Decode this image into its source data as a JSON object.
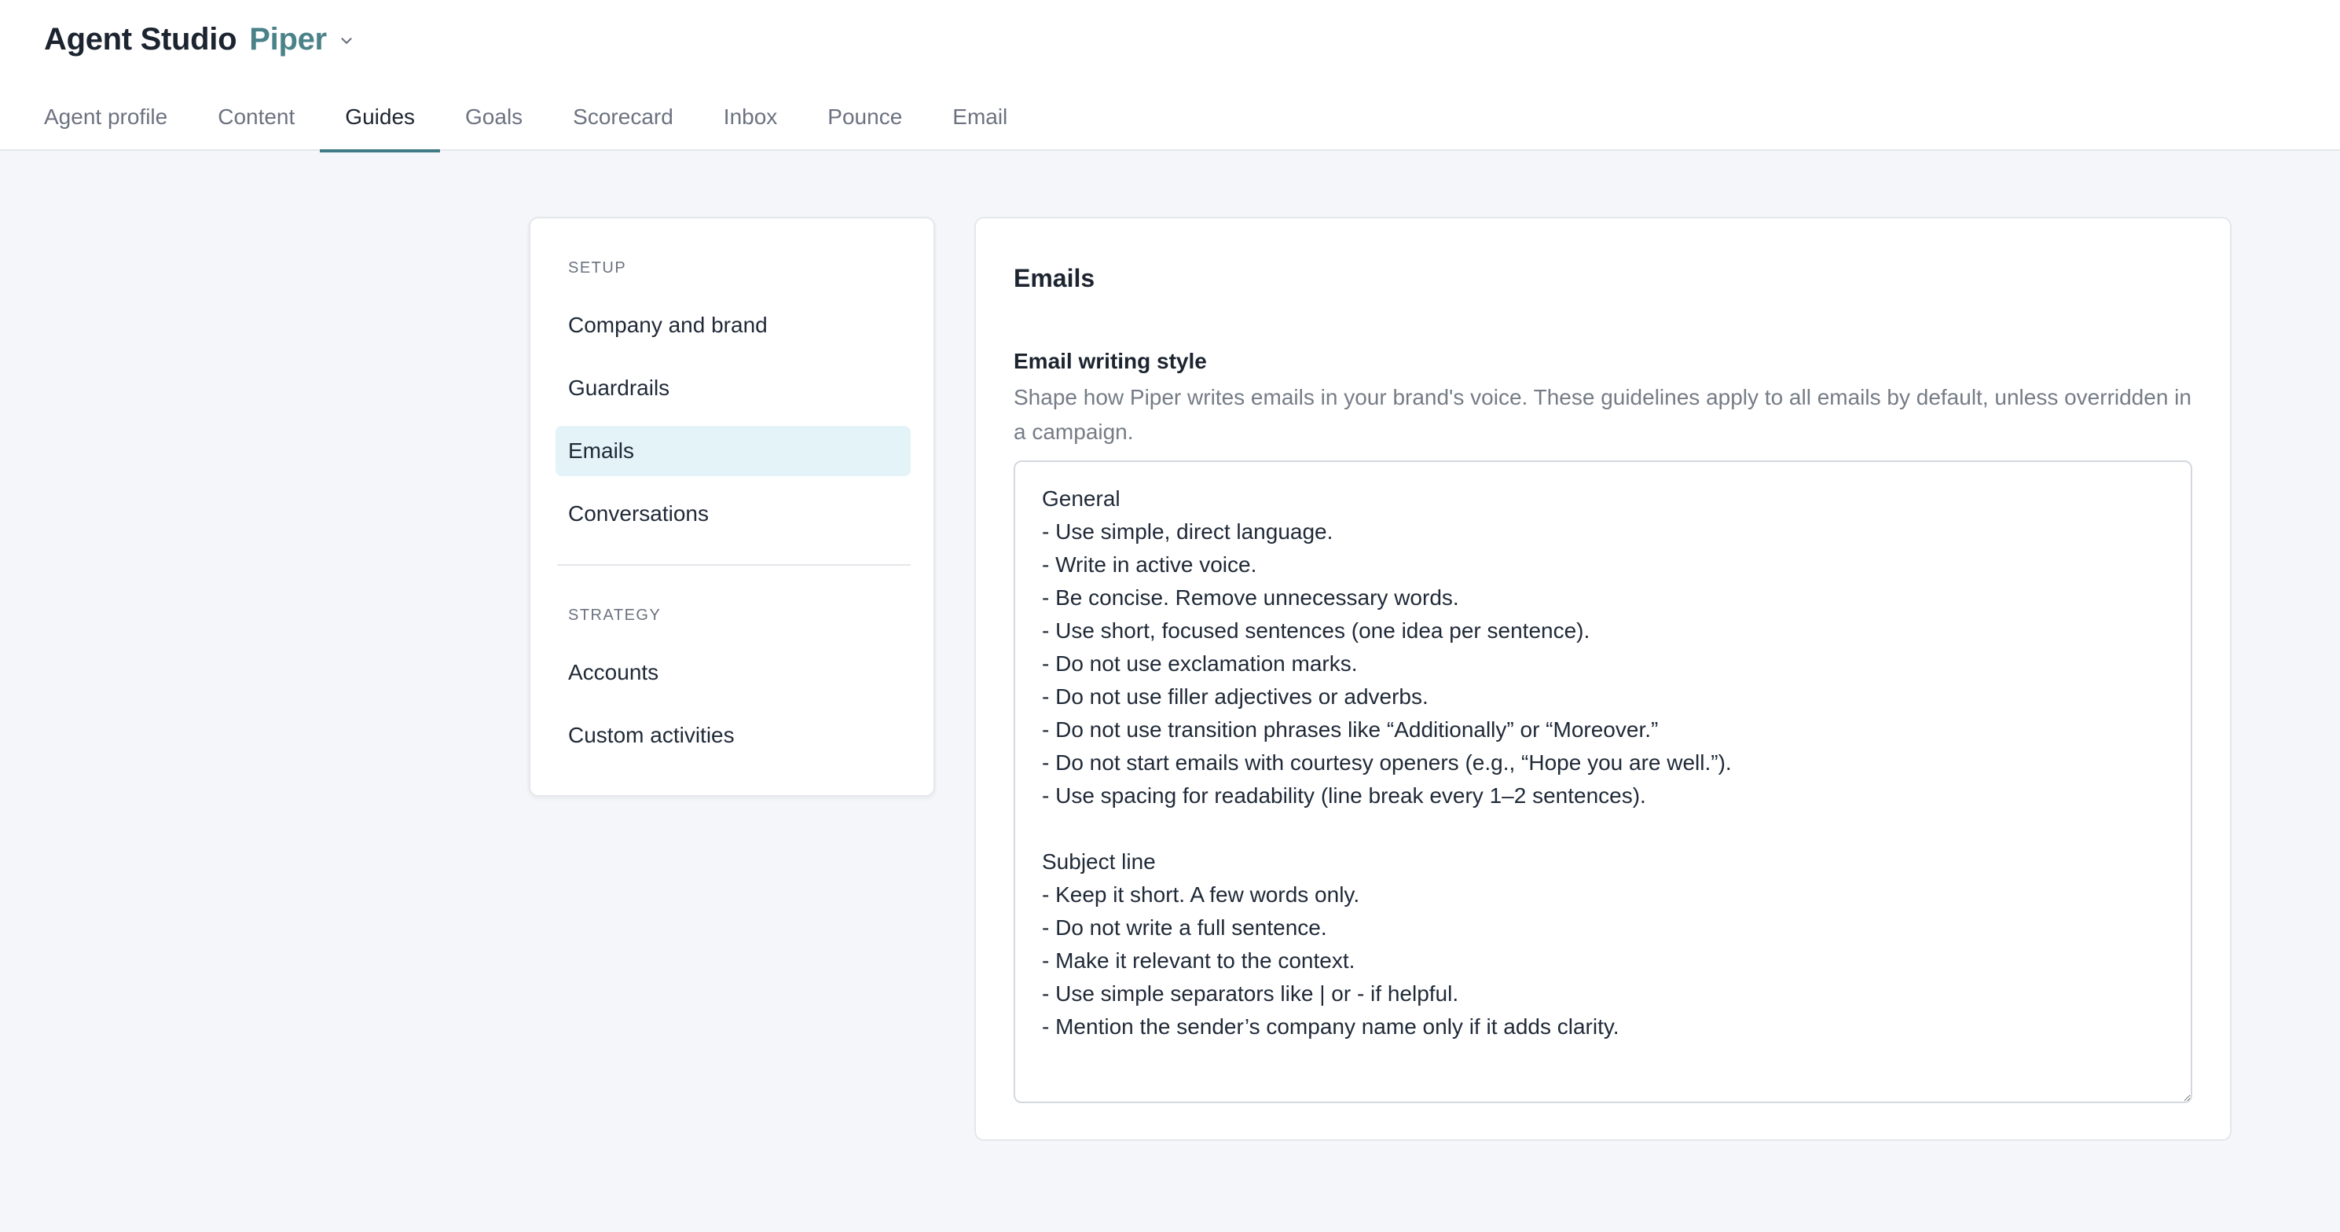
{
  "header": {
    "app_title": "Agent Studio",
    "agent_name": "Piper"
  },
  "tabs": [
    {
      "label": "Agent profile"
    },
    {
      "label": "Content"
    },
    {
      "label": "Guides",
      "active": true
    },
    {
      "label": "Goals"
    },
    {
      "label": "Scorecard"
    },
    {
      "label": "Inbox"
    },
    {
      "label": "Pounce"
    },
    {
      "label": "Email"
    }
  ],
  "sidebar": {
    "setup_label": "SETUP",
    "setup_items": [
      {
        "label": "Company and brand"
      },
      {
        "label": "Guardrails"
      },
      {
        "label": "Emails",
        "active": true
      },
      {
        "label": "Conversations"
      }
    ],
    "strategy_label": "STRATEGY",
    "strategy_items": [
      {
        "label": "Accounts"
      },
      {
        "label": "Custom activities"
      }
    ]
  },
  "main": {
    "title": "Emails",
    "writing_style": {
      "label": "Email writing style",
      "help": "Shape how Piper writes emails in your brand's voice. These guidelines apply to all emails by default, unless overridden in a campaign.",
      "value": "General\n- Use simple, direct language.\n- Write in active voice.\n- Be concise. Remove unnecessary words.\n- Use short, focused sentences (one idea per sentence).\n- Do not use exclamation marks.\n- Do not use filler adjectives or adverbs.\n- Do not use transition phrases like “Additionally” or “Moreover.”\n- Do not start emails with courtesy openers (e.g., “Hope you are well.”).\n- Use spacing for readability (line break every 1–2 sentences).\n\nSubject line\n- Keep it short. A few words only.\n- Do not write a full sentence.\n- Make it relevant to the context.\n- Use simple separators like | or - if helpful.\n- Mention the sender’s company name only if it adds clarity."
    }
  },
  "colors": {
    "accent": "#3f7a86",
    "agent_name": "#4b8289",
    "active_item_bg": "#e3f3f8",
    "page_bg": "#f4f6f9"
  },
  "icons": {
    "agent_dropdown": "chevron-down-icon"
  }
}
